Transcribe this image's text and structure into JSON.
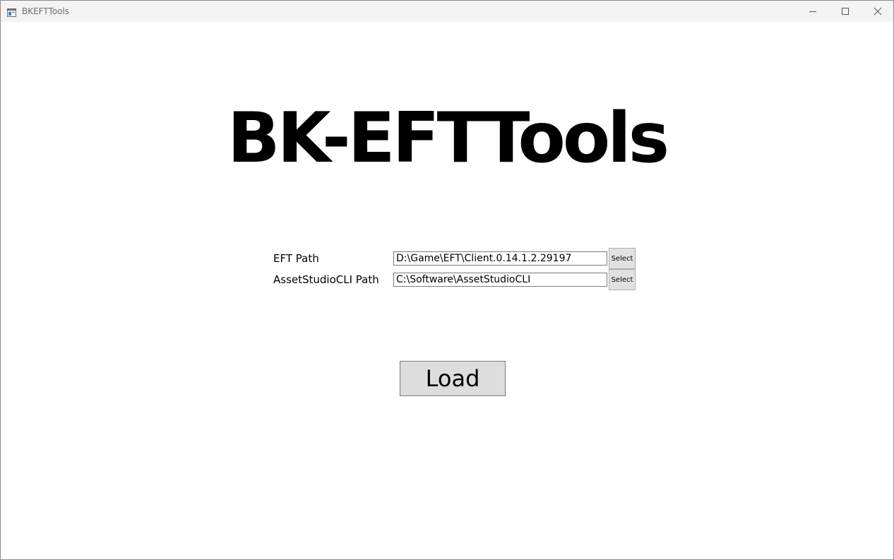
{
  "window": {
    "title": "BKEFTTools",
    "icon": "app-window-icon",
    "controls": {
      "minimize_icon": "minimize-icon",
      "maximize_icon": "maximize-icon",
      "close_icon": "close-icon"
    }
  },
  "main": {
    "title": "BK-EFTTools",
    "fields": [
      {
        "label": "EFT Path",
        "value": "D:\\Game\\EFT\\Client.0.14.1.2.29197",
        "button_label": "Select"
      },
      {
        "label": "AssetStudioCLI Path",
        "value": "C:\\Software\\AssetStudioCLI",
        "button_label": "Select"
      }
    ],
    "load_label": "Load"
  },
  "colors": {
    "titlebar_bg": "#f3f3f3",
    "button_bg": "#e1e1e1",
    "load_button_bg": "#dddddd",
    "text": "#000000"
  }
}
